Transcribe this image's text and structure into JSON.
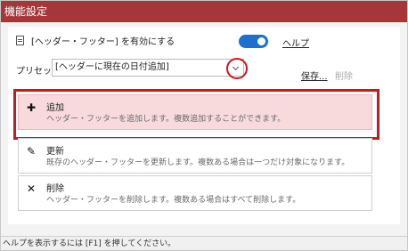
{
  "window": {
    "title": "機能設定"
  },
  "enable_row": {
    "label": "[ヘッダー・フッター] を有効にする",
    "toggle_on": true,
    "help_label": "ヘルプ"
  },
  "preset": {
    "label": "プリセット :",
    "selected": "[ヘッダーに現在の日付追加]"
  },
  "actions": {
    "save_label": "保存...",
    "delete_label": "削除"
  },
  "options": [
    {
      "title": "追加",
      "desc": "ヘッダー・フッターを追加します。複数追加することができます。",
      "icon": "plus-icon",
      "selected": true
    },
    {
      "title": "更新",
      "desc": "既存のヘッダー・フッターを更新します。複数ある場合は一つだけ対象になります。",
      "icon": "pen-icon",
      "selected": false
    },
    {
      "title": "削除",
      "desc": "ヘッダー・フッターを削除します。複数ある場合はすべて削除します。",
      "icon": "x-icon",
      "selected": false
    }
  ],
  "status": {
    "text": "ヘルプを表示するには [F1] を押してください。"
  },
  "colors": {
    "titlebar": "#a4373a",
    "accent": "#1f6fd1",
    "highlight": "#d0161b",
    "selected_bg": "#f8dadd"
  }
}
